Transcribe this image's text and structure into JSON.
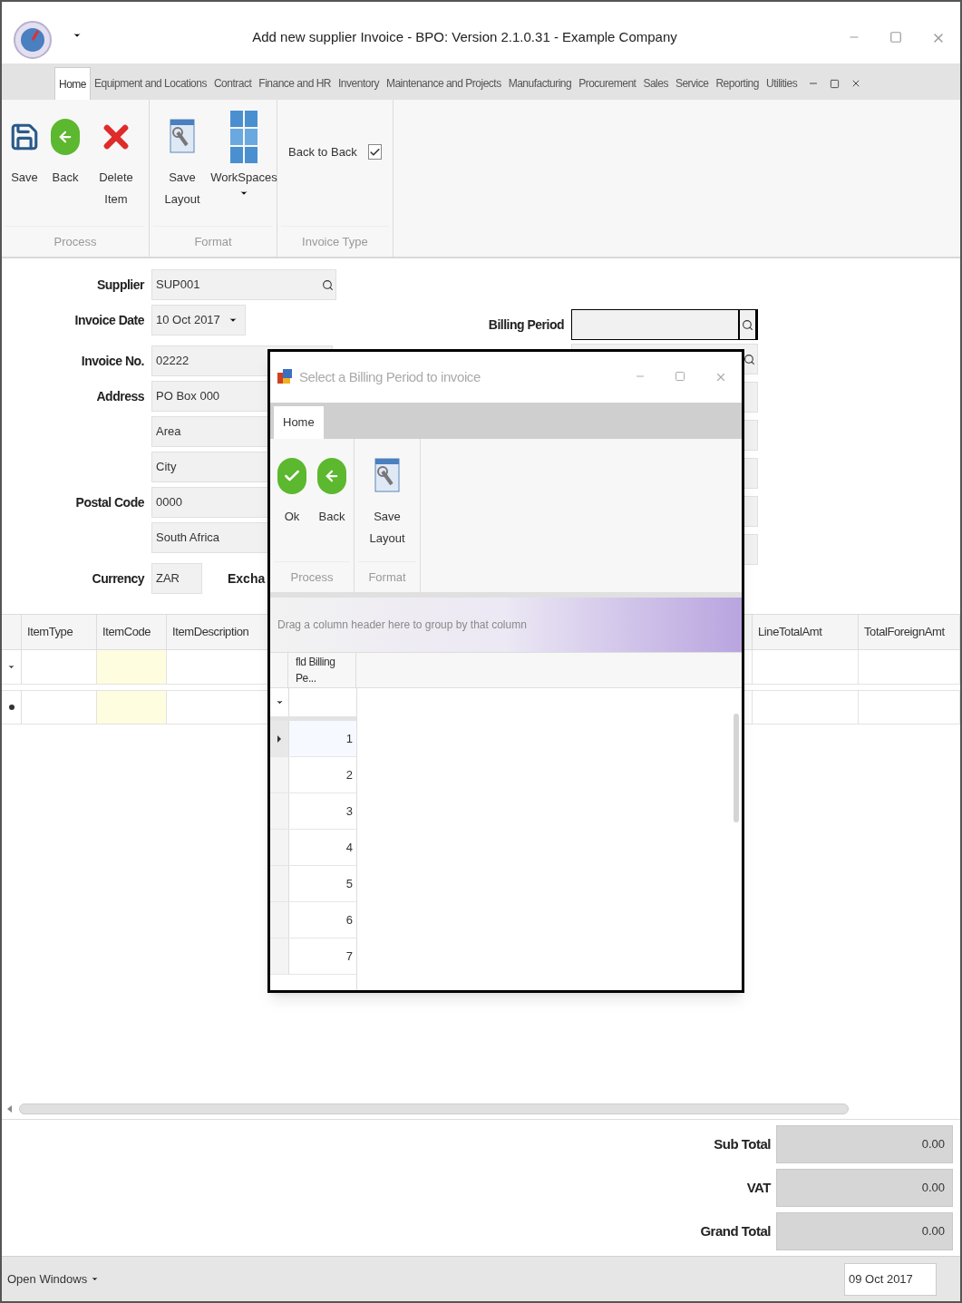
{
  "window": {
    "title": "Add new supplier Invoice - BPO: Version 2.1.0.31 - Example Company"
  },
  "tabs": [
    {
      "label": "Home",
      "selected": true
    },
    {
      "label": "Equipment and Locations",
      "selected": false
    },
    {
      "label": "Contract",
      "selected": false
    },
    {
      "label": "Finance and HR",
      "selected": false
    },
    {
      "label": "Inventory",
      "selected": false
    },
    {
      "label": "Maintenance and Projects",
      "selected": false
    },
    {
      "label": "Manufacturing",
      "selected": false
    },
    {
      "label": "Procurement",
      "selected": false
    },
    {
      "label": "Sales",
      "selected": false
    },
    {
      "label": "Service",
      "selected": false
    },
    {
      "label": "Reporting",
      "selected": false
    },
    {
      "label": "Utilities",
      "selected": false
    }
  ],
  "ribbon": [
    {
      "label": "Process",
      "items": [
        {
          "kind": "save",
          "label": "Save"
        },
        {
          "kind": "back",
          "label": "Back"
        },
        {
          "kind": "delete",
          "label": "Delete Item"
        }
      ]
    },
    {
      "label": "Format",
      "items": [
        {
          "kind": "layout",
          "label": "Save Layout"
        },
        {
          "kind": "workspaces",
          "label": "WorkSpaces"
        }
      ]
    },
    {
      "label": "Invoice Type",
      "items": [
        {
          "kind": "checkbox",
          "label": "Back to Back",
          "checked": true
        }
      ]
    }
  ],
  "form": {
    "left": [
      {
        "label": "Supplier",
        "value": "SUP001",
        "kind": "lookup"
      },
      {
        "label": "Invoice Date",
        "value": "10 Oct 2017",
        "kind": "date"
      },
      {
        "label": "Invoice No.",
        "value": "02222",
        "kind": "text"
      },
      {
        "label": "Address",
        "value": "PO Box 000",
        "kind": "text"
      },
      {
        "value": "Area",
        "kind": "text"
      },
      {
        "value": "City",
        "kind": "text"
      },
      {
        "label": "Postal Code",
        "value": "0000",
        "kind": "text"
      },
      {
        "value": "South Africa",
        "kind": "text"
      },
      {
        "label": "Currency",
        "value": "ZAR",
        "kind": "short",
        "extra_label": "Excha"
      }
    ],
    "right": [
      {
        "label": "Billing Period",
        "kind": "lookup",
        "focused": true
      },
      {
        "kind": "lookup",
        "focused": false
      },
      {
        "kind": "text",
        "focused": false
      },
      {
        "kind": "text",
        "focused": false
      },
      {
        "kind": "text",
        "focused": false
      },
      {
        "kind": "text",
        "focused": false
      },
      {
        "kind": "text",
        "focused": false
      }
    ]
  },
  "grid": {
    "columns": [
      "ItemType",
      "ItemCode",
      "ItemDescription",
      "LineTotalAmt",
      "TotalForeignAmt"
    ],
    "rows": [
      {
        "kind": "filter"
      },
      {
        "kind": "new"
      }
    ]
  },
  "totals": [
    {
      "label": "Sub Total",
      "value": "0.00"
    },
    {
      "label": "VAT",
      "value": "0.00"
    },
    {
      "label": "Grand Total",
      "value": "0.00"
    }
  ],
  "status_bar": {
    "open_windows": "Open Windows",
    "date": "09 Oct 2017"
  },
  "dialog": {
    "title": "Select a Billing Period to invoice",
    "tabs": [
      {
        "label": "Home",
        "selected": true
      }
    ],
    "ribbon": [
      {
        "label": "Process",
        "items": [
          {
            "kind": "ok",
            "label": "Ok"
          },
          {
            "kind": "back",
            "label": "Back"
          }
        ]
      },
      {
        "label": "Format",
        "items": [
          {
            "kind": "layout",
            "label": "Save Layout"
          }
        ]
      }
    ],
    "group_panel": "Drag a column header here to group by that column",
    "column": "fld Billing Pe...",
    "rows": [
      {
        "value": "1",
        "selected": true
      },
      {
        "value": "2",
        "selected": false
      },
      {
        "value": "3",
        "selected": false
      },
      {
        "value": "4",
        "selected": false
      },
      {
        "value": "5",
        "selected": false
      },
      {
        "value": "6",
        "selected": false
      },
      {
        "value": "7",
        "selected": false
      }
    ]
  }
}
